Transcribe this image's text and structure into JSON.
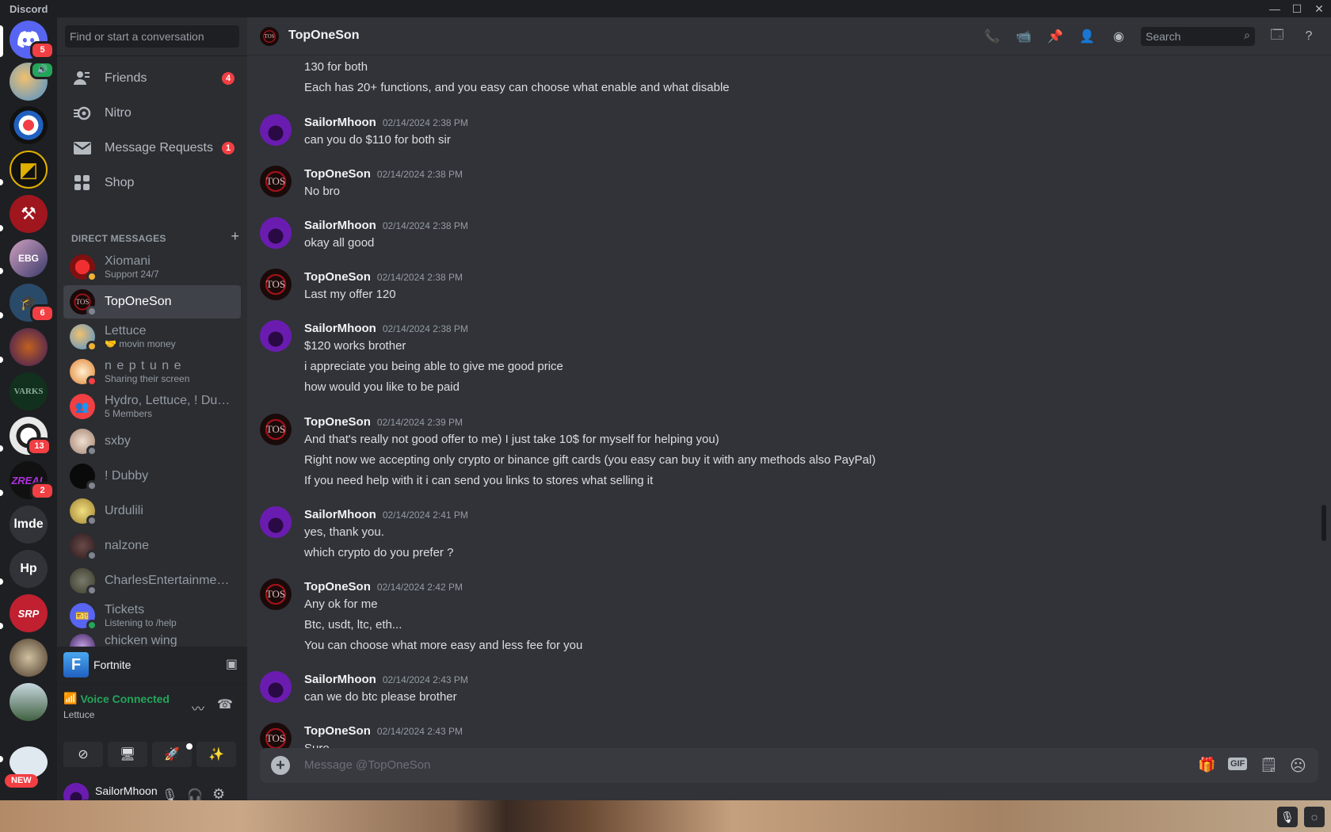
{
  "window": {
    "title": "Discord",
    "controls": [
      "—",
      "☐",
      "✕"
    ]
  },
  "servers": {
    "home_badge": "5",
    "items": [
      {
        "name": "server-1",
        "badge": ""
      },
      {
        "name": "server-2",
        "badge": ""
      },
      {
        "name": "server-3",
        "badge": ""
      },
      {
        "name": "server-4",
        "badge": ""
      },
      {
        "name": "server-5",
        "badge": ""
      },
      {
        "name": "server-6",
        "badge": "6"
      },
      {
        "name": "server-7",
        "badge": ""
      },
      {
        "name": "server-8",
        "badge": ""
      },
      {
        "name": "server-9",
        "badge": "13"
      },
      {
        "name": "server-10",
        "badge": "2"
      },
      {
        "name": "lmde",
        "label": "lmde"
      },
      {
        "name": "hp",
        "label": "Hp"
      }
    ],
    "new_badge": "NEW"
  },
  "sidebar": {
    "search_placeholder": "Find or start a conversation",
    "nav": [
      {
        "label": "Friends",
        "badge": "4"
      },
      {
        "label": "Nitro",
        "badge": ""
      },
      {
        "label": "Message Requests",
        "badge": "1"
      },
      {
        "label": "Shop",
        "badge": ""
      }
    ],
    "dm_header": "DIRECT MESSAGES",
    "dms": [
      {
        "name": "Xiomani",
        "sub": "Support 24/7"
      },
      {
        "name": "TopOneSon",
        "sub": ""
      },
      {
        "name": "Lettuce",
        "sub": "🤝 movin money"
      },
      {
        "name": "n e p t u n e",
        "sub": "Sharing their screen"
      },
      {
        "name": "Hydro, Lettuce, ! Dub...",
        "sub": "5 Members"
      },
      {
        "name": "sxby",
        "sub": ""
      },
      {
        "name": "! Dubby",
        "sub": ""
      },
      {
        "name": "Urdulili",
        "sub": ""
      },
      {
        "name": "nalzone",
        "sub": ""
      },
      {
        "name": "CharlesEntertainmen...",
        "sub": ""
      },
      {
        "name": "Tickets",
        "sub": "Listening to /help"
      },
      {
        "name": "chicken wing",
        "sub": ""
      }
    ],
    "activity": {
      "game": "Fortnite",
      "icon_letter": "F"
    },
    "voice": {
      "status": "Voice Connected",
      "channel": "Lettuce"
    },
    "user": {
      "name": "SailorMhoon"
    }
  },
  "chat": {
    "title": "TopOneSon",
    "search_placeholder": "Search",
    "composer_placeholder": "Message @TopOneSon",
    "gif_label": "GIF",
    "top_lines": [
      "130 for both",
      "Each has 20+ functions, and you easy can choose what enable and what disable"
    ],
    "groups": [
      {
        "author": "SailorMhoon",
        "time": "02/14/2024 2:38 PM",
        "lines": [
          "can you do $110 for both sir"
        ]
      },
      {
        "author": "TopOneSon",
        "time": "02/14/2024 2:38 PM",
        "lines": [
          "No bro"
        ]
      },
      {
        "author": "SailorMhoon",
        "time": "02/14/2024 2:38 PM",
        "lines": [
          "okay all good"
        ]
      },
      {
        "author": "TopOneSon",
        "time": "02/14/2024 2:38 PM",
        "lines": [
          "Last my offer 120"
        ]
      },
      {
        "author": "SailorMhoon",
        "time": "02/14/2024 2:38 PM",
        "lines": [
          "$120 works brother",
          "i appreciate you being able to give me good price",
          "how would you like to be paid"
        ]
      },
      {
        "author": "TopOneSon",
        "time": "02/14/2024 2:39 PM",
        "lines": [
          "And that's really not good offer to me) I just take 10$ for myself for helping you)",
          "Right now we accepting only crypto or binance gift cards (you easy can buy it with any methods also PayPal)",
          "If you need help with it i can send you links to stores what selling it"
        ]
      },
      {
        "author": "SailorMhoon",
        "time": "02/14/2024 2:41 PM",
        "lines": [
          "yes, thank you.",
          "which crypto do you prefer ?"
        ]
      },
      {
        "author": "TopOneSon",
        "time": "02/14/2024 2:42 PM",
        "lines": [
          "Any ok for me",
          "Btc, usdt, ltc, eth...",
          "You can choose what more easy and less fee for you"
        ]
      },
      {
        "author": "SailorMhoon",
        "time": "02/14/2024 2:43 PM",
        "lines": [
          "can we do btc please brother"
        ]
      },
      {
        "author": "TopOneSon",
        "time": "02/14/2024 2:43 PM",
        "lines": [
          "Sure"
        ]
      }
    ]
  },
  "colors": {
    "accent": "#5865f2",
    "online": "#23a55a",
    "dnd": "#f23f43",
    "voice_green": "#23a55a"
  }
}
